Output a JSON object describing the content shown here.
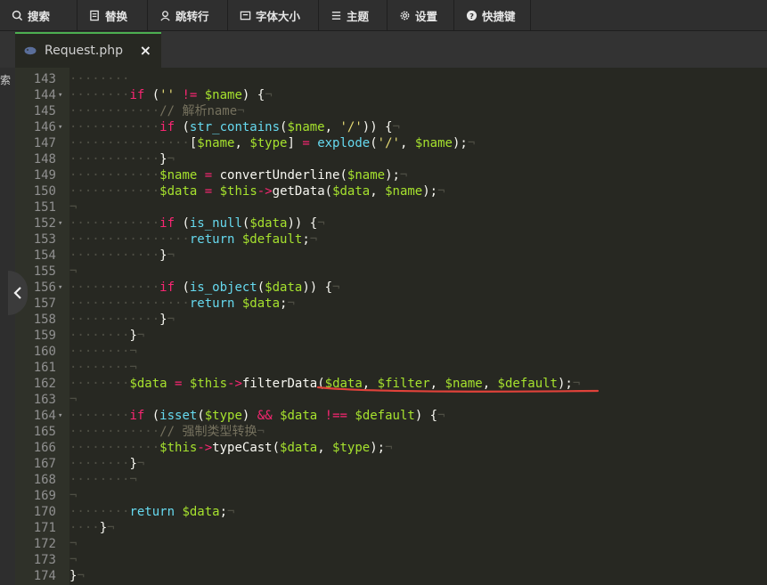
{
  "toolbar": {
    "items": [
      {
        "label": "搜索",
        "icon": "search-icon"
      },
      {
        "label": "替换",
        "icon": "replace-icon"
      },
      {
        "label": "跳转行",
        "icon": "goto-line-icon"
      },
      {
        "label": "字体大小",
        "icon": "font-size-icon"
      },
      {
        "label": "主题",
        "icon": "theme-icon"
      },
      {
        "label": "设置",
        "icon": "gear-icon"
      },
      {
        "label": "快捷键",
        "icon": "help-icon"
      }
    ]
  },
  "tab": {
    "filename": "Request.php",
    "close": "×",
    "icon": "php-elephant-icon"
  },
  "sidebar": {
    "clipped_text": "索"
  },
  "colors": {
    "accent": "#4caf50",
    "background": "#272822",
    "keyword": "#f92672",
    "variable": "#a6e22e",
    "function": "#66d9ef",
    "string": "#e6db74",
    "comment": "#75715e"
  },
  "lines": [
    {
      "n": "143",
      "fold": false,
      "t": [
        [
          "d",
          "········"
        ]
      ]
    },
    {
      "n": "144",
      "fold": true,
      "t": [
        [
          "d",
          "········"
        ],
        [
          "kw",
          "if"
        ],
        [
          "p",
          " ("
        ],
        [
          "str",
          "''"
        ],
        [
          "p",
          " "
        ],
        [
          "op",
          "!="
        ],
        [
          "p",
          " "
        ],
        [
          "var",
          "$name"
        ],
        [
          "p",
          ") {"
        ],
        [
          "d",
          "¬"
        ]
      ]
    },
    {
      "n": "145",
      "fold": false,
      "t": [
        [
          "d",
          "············"
        ],
        [
          "cm",
          "// 解析name"
        ],
        [
          "d",
          "¬"
        ]
      ]
    },
    {
      "n": "146",
      "fold": true,
      "t": [
        [
          "d",
          "············"
        ],
        [
          "kw",
          "if"
        ],
        [
          "p",
          " ("
        ],
        [
          "fn",
          "str_contains"
        ],
        [
          "p",
          "("
        ],
        [
          "var",
          "$name"
        ],
        [
          "p",
          ", "
        ],
        [
          "str",
          "'/'"
        ],
        [
          "p",
          ")) {"
        ],
        [
          "d",
          "¬"
        ]
      ]
    },
    {
      "n": "147",
      "fold": false,
      "t": [
        [
          "d",
          "················"
        ],
        [
          "p",
          "["
        ],
        [
          "var",
          "$name"
        ],
        [
          "p",
          ", "
        ],
        [
          "var",
          "$type"
        ],
        [
          "p",
          "] "
        ],
        [
          "op",
          "="
        ],
        [
          "p",
          " "
        ],
        [
          "fn",
          "explode"
        ],
        [
          "p",
          "("
        ],
        [
          "str",
          "'/'"
        ],
        [
          "p",
          ", "
        ],
        [
          "var",
          "$name"
        ],
        [
          "p",
          ");"
        ],
        [
          "d",
          "¬"
        ]
      ]
    },
    {
      "n": "148",
      "fold": false,
      "t": [
        [
          "d",
          "············"
        ],
        [
          "p",
          "}"
        ],
        [
          "d",
          "¬"
        ]
      ]
    },
    {
      "n": "149",
      "fold": false,
      "t": [
        [
          "d",
          "············"
        ],
        [
          "var",
          "$name"
        ],
        [
          "p",
          " "
        ],
        [
          "op",
          "="
        ],
        [
          "p",
          " convertUnderline("
        ],
        [
          "var",
          "$name"
        ],
        [
          "p",
          ");"
        ],
        [
          "d",
          "¬"
        ]
      ]
    },
    {
      "n": "150",
      "fold": false,
      "t": [
        [
          "d",
          "············"
        ],
        [
          "var",
          "$data"
        ],
        [
          "p",
          " "
        ],
        [
          "op",
          "="
        ],
        [
          "p",
          " "
        ],
        [
          "var",
          "$this"
        ],
        [
          "op",
          "->"
        ],
        [
          "p",
          "getData("
        ],
        [
          "var",
          "$data"
        ],
        [
          "p",
          ", "
        ],
        [
          "var",
          "$name"
        ],
        [
          "p",
          ");"
        ],
        [
          "d",
          "¬"
        ]
      ]
    },
    {
      "n": "151",
      "fold": false,
      "t": [
        [
          "d",
          "¬"
        ]
      ]
    },
    {
      "n": "152",
      "fold": true,
      "t": [
        [
          "d",
          "············"
        ],
        [
          "kw",
          "if"
        ],
        [
          "p",
          " ("
        ],
        [
          "fn",
          "is_null"
        ],
        [
          "p",
          "("
        ],
        [
          "var",
          "$data"
        ],
        [
          "p",
          ")) {"
        ],
        [
          "d",
          "¬"
        ]
      ]
    },
    {
      "n": "153",
      "fold": false,
      "t": [
        [
          "d",
          "················"
        ],
        [
          "fn",
          "return"
        ],
        [
          "p",
          " "
        ],
        [
          "var",
          "$default"
        ],
        [
          "p",
          ";"
        ],
        [
          "d",
          "¬"
        ]
      ]
    },
    {
      "n": "154",
      "fold": false,
      "t": [
        [
          "d",
          "············"
        ],
        [
          "p",
          "}"
        ],
        [
          "d",
          "¬"
        ]
      ]
    },
    {
      "n": "155",
      "fold": false,
      "t": [
        [
          "d",
          "¬"
        ]
      ]
    },
    {
      "n": "156",
      "fold": true,
      "t": [
        [
          "d",
          "············"
        ],
        [
          "kw",
          "if"
        ],
        [
          "p",
          " ("
        ],
        [
          "fn",
          "is_object"
        ],
        [
          "p",
          "("
        ],
        [
          "var",
          "$data"
        ],
        [
          "p",
          ")) {"
        ],
        [
          "d",
          "¬"
        ]
      ]
    },
    {
      "n": "157",
      "fold": false,
      "t": [
        [
          "d",
          "················"
        ],
        [
          "fn",
          "return"
        ],
        [
          "p",
          " "
        ],
        [
          "var",
          "$data"
        ],
        [
          "p",
          ";"
        ],
        [
          "d",
          "¬"
        ]
      ]
    },
    {
      "n": "158",
      "fold": false,
      "t": [
        [
          "d",
          "············"
        ],
        [
          "p",
          "}"
        ],
        [
          "d",
          "¬"
        ]
      ]
    },
    {
      "n": "159",
      "fold": false,
      "t": [
        [
          "d",
          "········"
        ],
        [
          "p",
          "}"
        ],
        [
          "d",
          "¬"
        ]
      ]
    },
    {
      "n": "160",
      "fold": false,
      "t": [
        [
          "d",
          "········¬"
        ]
      ]
    },
    {
      "n": "161",
      "fold": false,
      "t": [
        [
          "d",
          "········¬"
        ]
      ]
    },
    {
      "n": "162",
      "fold": false,
      "t": [
        [
          "d",
          "········"
        ],
        [
          "var",
          "$data"
        ],
        [
          "p",
          " "
        ],
        [
          "op",
          "="
        ],
        [
          "p",
          " "
        ],
        [
          "var",
          "$this"
        ],
        [
          "op",
          "->"
        ],
        [
          "p",
          "filterData("
        ],
        [
          "var",
          "$data"
        ],
        [
          "p",
          ", "
        ],
        [
          "var",
          "$filter"
        ],
        [
          "p",
          ", "
        ],
        [
          "var",
          "$name"
        ],
        [
          "p",
          ", "
        ],
        [
          "var",
          "$default"
        ],
        [
          "p",
          ");"
        ],
        [
          "d",
          "¬"
        ]
      ]
    },
    {
      "n": "163",
      "fold": false,
      "t": [
        [
          "d",
          "¬"
        ]
      ]
    },
    {
      "n": "164",
      "fold": true,
      "t": [
        [
          "d",
          "········"
        ],
        [
          "kw",
          "if"
        ],
        [
          "p",
          " ("
        ],
        [
          "fn",
          "isset"
        ],
        [
          "p",
          "("
        ],
        [
          "var",
          "$type"
        ],
        [
          "p",
          ") "
        ],
        [
          "op",
          "&&"
        ],
        [
          "p",
          " "
        ],
        [
          "var",
          "$data"
        ],
        [
          "p",
          " "
        ],
        [
          "op",
          "!=="
        ],
        [
          "p",
          " "
        ],
        [
          "var",
          "$default"
        ],
        [
          "p",
          ") {"
        ],
        [
          "d",
          "¬"
        ]
      ]
    },
    {
      "n": "165",
      "fold": false,
      "t": [
        [
          "d",
          "············"
        ],
        [
          "cm",
          "// 强制类型转换"
        ],
        [
          "d",
          "¬"
        ]
      ]
    },
    {
      "n": "166",
      "fold": false,
      "t": [
        [
          "d",
          "············"
        ],
        [
          "var",
          "$this"
        ],
        [
          "op",
          "->"
        ],
        [
          "p",
          "typeCast("
        ],
        [
          "var",
          "$data"
        ],
        [
          "p",
          ", "
        ],
        [
          "var",
          "$type"
        ],
        [
          "p",
          ");"
        ],
        [
          "d",
          "¬"
        ]
      ]
    },
    {
      "n": "167",
      "fold": false,
      "t": [
        [
          "d",
          "········"
        ],
        [
          "p",
          "}"
        ],
        [
          "d",
          "¬"
        ]
      ]
    },
    {
      "n": "168",
      "fold": false,
      "t": [
        [
          "d",
          "········¬"
        ]
      ]
    },
    {
      "n": "169",
      "fold": false,
      "t": [
        [
          "d",
          "¬"
        ]
      ]
    },
    {
      "n": "170",
      "fold": false,
      "t": [
        [
          "d",
          "········"
        ],
        [
          "fn",
          "return"
        ],
        [
          "p",
          " "
        ],
        [
          "var",
          "$data"
        ],
        [
          "p",
          ";"
        ],
        [
          "d",
          "¬"
        ]
      ]
    },
    {
      "n": "171",
      "fold": false,
      "t": [
        [
          "d",
          "····"
        ],
        [
          "p",
          "}"
        ],
        [
          "d",
          "¬"
        ]
      ]
    },
    {
      "n": "172",
      "fold": false,
      "t": [
        [
          "d",
          "¬"
        ]
      ]
    },
    {
      "n": "173",
      "fold": false,
      "t": [
        [
          "d",
          "¬"
        ]
      ]
    },
    {
      "n": "174",
      "fold": false,
      "t": [
        [
          "p",
          "}"
        ],
        [
          "d",
          "¬"
        ]
      ]
    }
  ]
}
